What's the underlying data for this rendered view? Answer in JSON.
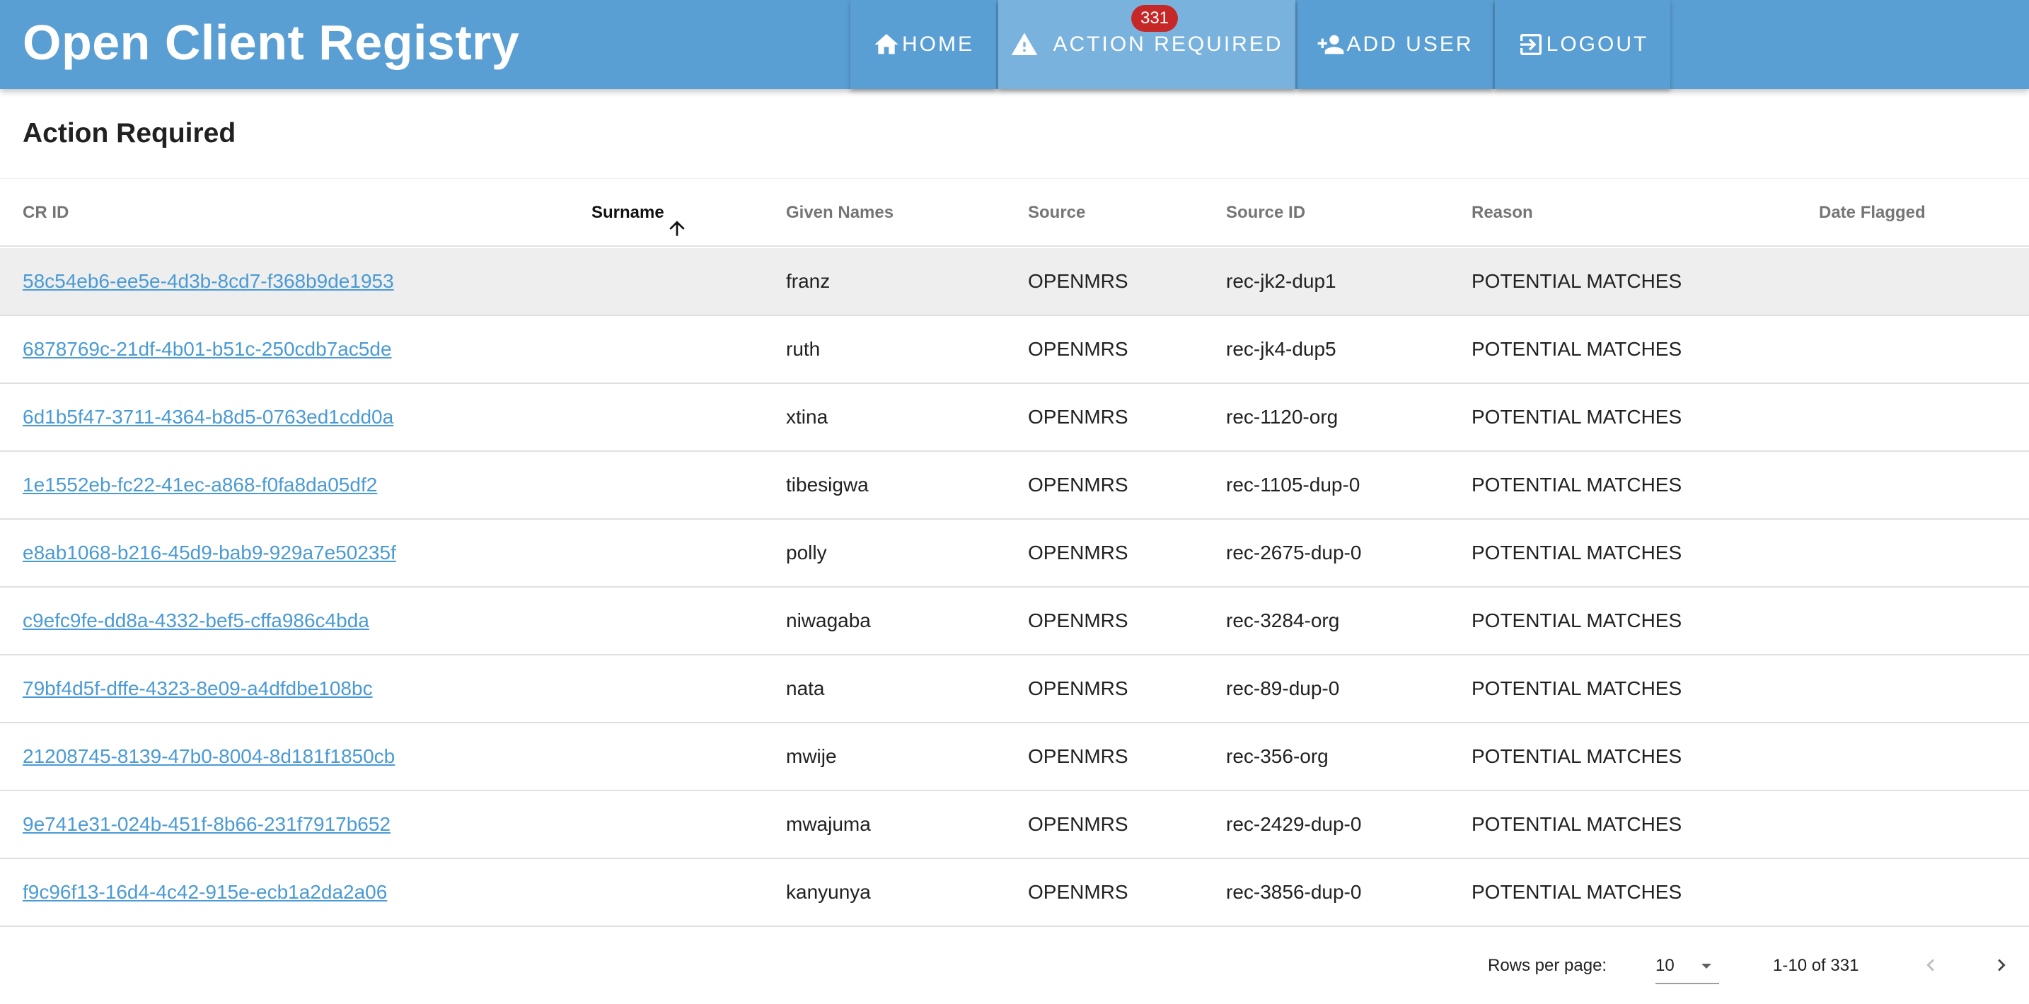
{
  "app": {
    "title": "Open Client Registry"
  },
  "nav": {
    "home_label": "HOME",
    "action_label": "ACTION REQUIRED",
    "action_badge": "331",
    "adduser_label": "ADD USER",
    "logout_label": "LOGOUT"
  },
  "page": {
    "title": "Action Required"
  },
  "table": {
    "columns": {
      "crid": "CR ID",
      "surname": "Surname",
      "given": "Given Names",
      "source": "Source",
      "sourceid": "Source ID",
      "reason": "Reason",
      "date": "Date Flagged"
    },
    "sort": {
      "column": "Surname",
      "direction": "ascending"
    },
    "rows": [
      {
        "crid": "58c54eb6-ee5e-4d3b-8cd7-f368b9de1953",
        "surname": "",
        "given": "franz",
        "source": "OPENMRS",
        "sourceid": "rec-jk2-dup1",
        "reason": "POTENTIAL MATCHES",
        "date": ""
      },
      {
        "crid": "6878769c-21df-4b01-b51c-250cdb7ac5de",
        "surname": "",
        "given": "ruth",
        "source": "OPENMRS",
        "sourceid": "rec-jk4-dup5",
        "reason": "POTENTIAL MATCHES",
        "date": ""
      },
      {
        "crid": "6d1b5f47-3711-4364-b8d5-0763ed1cdd0a",
        "surname": "",
        "given": "xtina",
        "source": "OPENMRS",
        "sourceid": "rec-1120-org",
        "reason": "POTENTIAL MATCHES",
        "date": ""
      },
      {
        "crid": "1e1552eb-fc22-41ec-a868-f0fa8da05df2",
        "surname": "",
        "given": "tibesigwa",
        "source": "OPENMRS",
        "sourceid": "rec-1105-dup-0",
        "reason": "POTENTIAL MATCHES",
        "date": ""
      },
      {
        "crid": "e8ab1068-b216-45d9-bab9-929a7e50235f",
        "surname": "",
        "given": "polly",
        "source": "OPENMRS",
        "sourceid": "rec-2675-dup-0",
        "reason": "POTENTIAL MATCHES",
        "date": ""
      },
      {
        "crid": "c9efc9fe-dd8a-4332-bef5-cffa986c4bda",
        "surname": "",
        "given": "niwagaba",
        "source": "OPENMRS",
        "sourceid": "rec-3284-org",
        "reason": "POTENTIAL MATCHES",
        "date": ""
      },
      {
        "crid": "79bf4d5f-dffe-4323-8e09-a4dfdbe108bc",
        "surname": "",
        "given": "nata",
        "source": "OPENMRS",
        "sourceid": "rec-89-dup-0",
        "reason": "POTENTIAL MATCHES",
        "date": ""
      },
      {
        "crid": "21208745-8139-47b0-8004-8d181f1850cb",
        "surname": "",
        "given": "mwije",
        "source": "OPENMRS",
        "sourceid": "rec-356-org",
        "reason": "POTENTIAL MATCHES",
        "date": ""
      },
      {
        "crid": "9e741e31-024b-451f-8b66-231f7917b652",
        "surname": "",
        "given": "mwajuma",
        "source": "OPENMRS",
        "sourceid": "rec-2429-dup-0",
        "reason": "POTENTIAL MATCHES",
        "date": ""
      },
      {
        "crid": "f9c96f13-16d4-4c42-915e-ecb1a2da2a06",
        "surname": "",
        "given": "kanyunya",
        "source": "OPENMRS",
        "sourceid": "rec-3856-dup-0",
        "reason": "POTENTIAL MATCHES",
        "date": ""
      }
    ]
  },
  "pagination": {
    "rows_per_page_label": "Rows per page:",
    "rows_per_page_value": "10",
    "range_text": "1-10 of 331"
  },
  "icons": {
    "home": "home-icon",
    "action": "warning-icon",
    "adduser": "person-add-icon",
    "logout": "logout-icon",
    "sort": "arrow-up-icon",
    "dropdown": "caret-down-icon",
    "prev": "chevron-left-icon",
    "next": "chevron-right-icon"
  },
  "colors": {
    "appbar": "#5a9fd4",
    "appbar_active": "#7ab2de",
    "badge": "#c62828",
    "link": "#4a9ad4",
    "hover_row": "#eeeeee"
  }
}
